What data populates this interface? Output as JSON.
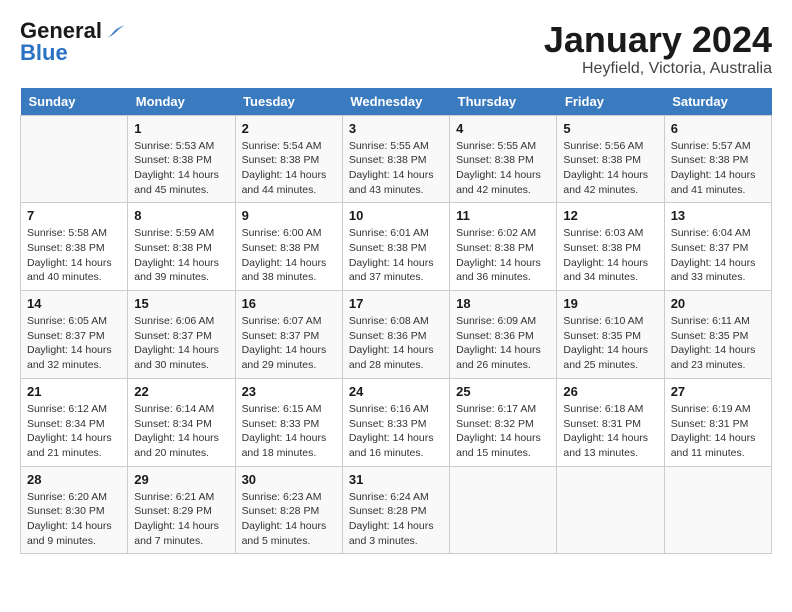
{
  "logo": {
    "general": "General",
    "blue": "Blue"
  },
  "title": "January 2024",
  "subtitle": "Heyfield, Victoria, Australia",
  "days_of_week": [
    "Sunday",
    "Monday",
    "Tuesday",
    "Wednesday",
    "Thursday",
    "Friday",
    "Saturday"
  ],
  "weeks": [
    [
      {
        "day": "",
        "info": ""
      },
      {
        "day": "1",
        "info": "Sunrise: 5:53 AM\nSunset: 8:38 PM\nDaylight: 14 hours\nand 45 minutes."
      },
      {
        "day": "2",
        "info": "Sunrise: 5:54 AM\nSunset: 8:38 PM\nDaylight: 14 hours\nand 44 minutes."
      },
      {
        "day": "3",
        "info": "Sunrise: 5:55 AM\nSunset: 8:38 PM\nDaylight: 14 hours\nand 43 minutes."
      },
      {
        "day": "4",
        "info": "Sunrise: 5:55 AM\nSunset: 8:38 PM\nDaylight: 14 hours\nand 42 minutes."
      },
      {
        "day": "5",
        "info": "Sunrise: 5:56 AM\nSunset: 8:38 PM\nDaylight: 14 hours\nand 42 minutes."
      },
      {
        "day": "6",
        "info": "Sunrise: 5:57 AM\nSunset: 8:38 PM\nDaylight: 14 hours\nand 41 minutes."
      }
    ],
    [
      {
        "day": "7",
        "info": "Sunrise: 5:58 AM\nSunset: 8:38 PM\nDaylight: 14 hours\nand 40 minutes."
      },
      {
        "day": "8",
        "info": "Sunrise: 5:59 AM\nSunset: 8:38 PM\nDaylight: 14 hours\nand 39 minutes."
      },
      {
        "day": "9",
        "info": "Sunrise: 6:00 AM\nSunset: 8:38 PM\nDaylight: 14 hours\nand 38 minutes."
      },
      {
        "day": "10",
        "info": "Sunrise: 6:01 AM\nSunset: 8:38 PM\nDaylight: 14 hours\nand 37 minutes."
      },
      {
        "day": "11",
        "info": "Sunrise: 6:02 AM\nSunset: 8:38 PM\nDaylight: 14 hours\nand 36 minutes."
      },
      {
        "day": "12",
        "info": "Sunrise: 6:03 AM\nSunset: 8:38 PM\nDaylight: 14 hours\nand 34 minutes."
      },
      {
        "day": "13",
        "info": "Sunrise: 6:04 AM\nSunset: 8:37 PM\nDaylight: 14 hours\nand 33 minutes."
      }
    ],
    [
      {
        "day": "14",
        "info": "Sunrise: 6:05 AM\nSunset: 8:37 PM\nDaylight: 14 hours\nand 32 minutes."
      },
      {
        "day": "15",
        "info": "Sunrise: 6:06 AM\nSunset: 8:37 PM\nDaylight: 14 hours\nand 30 minutes."
      },
      {
        "day": "16",
        "info": "Sunrise: 6:07 AM\nSunset: 8:37 PM\nDaylight: 14 hours\nand 29 minutes."
      },
      {
        "day": "17",
        "info": "Sunrise: 6:08 AM\nSunset: 8:36 PM\nDaylight: 14 hours\nand 28 minutes."
      },
      {
        "day": "18",
        "info": "Sunrise: 6:09 AM\nSunset: 8:36 PM\nDaylight: 14 hours\nand 26 minutes."
      },
      {
        "day": "19",
        "info": "Sunrise: 6:10 AM\nSunset: 8:35 PM\nDaylight: 14 hours\nand 25 minutes."
      },
      {
        "day": "20",
        "info": "Sunrise: 6:11 AM\nSunset: 8:35 PM\nDaylight: 14 hours\nand 23 minutes."
      }
    ],
    [
      {
        "day": "21",
        "info": "Sunrise: 6:12 AM\nSunset: 8:34 PM\nDaylight: 14 hours\nand 21 minutes."
      },
      {
        "day": "22",
        "info": "Sunrise: 6:14 AM\nSunset: 8:34 PM\nDaylight: 14 hours\nand 20 minutes."
      },
      {
        "day": "23",
        "info": "Sunrise: 6:15 AM\nSunset: 8:33 PM\nDaylight: 14 hours\nand 18 minutes."
      },
      {
        "day": "24",
        "info": "Sunrise: 6:16 AM\nSunset: 8:33 PM\nDaylight: 14 hours\nand 16 minutes."
      },
      {
        "day": "25",
        "info": "Sunrise: 6:17 AM\nSunset: 8:32 PM\nDaylight: 14 hours\nand 15 minutes."
      },
      {
        "day": "26",
        "info": "Sunrise: 6:18 AM\nSunset: 8:31 PM\nDaylight: 14 hours\nand 13 minutes."
      },
      {
        "day": "27",
        "info": "Sunrise: 6:19 AM\nSunset: 8:31 PM\nDaylight: 14 hours\nand 11 minutes."
      }
    ],
    [
      {
        "day": "28",
        "info": "Sunrise: 6:20 AM\nSunset: 8:30 PM\nDaylight: 14 hours\nand 9 minutes."
      },
      {
        "day": "29",
        "info": "Sunrise: 6:21 AM\nSunset: 8:29 PM\nDaylight: 14 hours\nand 7 minutes."
      },
      {
        "day": "30",
        "info": "Sunrise: 6:23 AM\nSunset: 8:28 PM\nDaylight: 14 hours\nand 5 minutes."
      },
      {
        "day": "31",
        "info": "Sunrise: 6:24 AM\nSunset: 8:28 PM\nDaylight: 14 hours\nand 3 minutes."
      },
      {
        "day": "",
        "info": ""
      },
      {
        "day": "",
        "info": ""
      },
      {
        "day": "",
        "info": ""
      }
    ]
  ]
}
